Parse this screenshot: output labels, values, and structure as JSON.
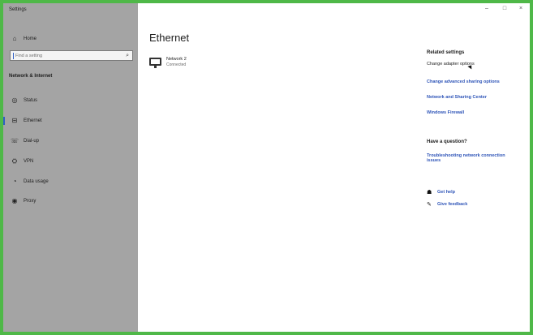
{
  "window": {
    "title": "Settings",
    "minimize": "–",
    "maximize": "□",
    "close": "×"
  },
  "sidebar": {
    "home": {
      "icon": "home-icon",
      "glyph": "⌂",
      "label": "Home"
    },
    "search": {
      "placeholder": "Find a setting",
      "icon": "search-icon",
      "glyph": "⌕"
    },
    "section": "Network & Internet",
    "items": [
      {
        "id": "status",
        "icon": "globe-icon",
        "glyph": "◎",
        "label": "Status",
        "active": false
      },
      {
        "id": "ethernet",
        "icon": "ethernet-icon",
        "glyph": "⊟",
        "label": "Ethernet",
        "active": true
      },
      {
        "id": "dialup",
        "icon": "phone-icon",
        "glyph": "☏",
        "label": "Dial-up",
        "active": false
      },
      {
        "id": "vpn",
        "icon": "vpn-icon",
        "glyph": "⛭",
        "label": "VPN",
        "active": false
      },
      {
        "id": "datausage",
        "icon": "data-usage-icon",
        "glyph": "◔",
        "label": "Data usage",
        "active": false
      },
      {
        "id": "proxy",
        "icon": "proxy-icon",
        "glyph": "◉",
        "label": "Proxy",
        "active": false
      }
    ]
  },
  "main": {
    "title": "Ethernet",
    "network": {
      "icon": "monitor-icon",
      "name": "Network 2",
      "status": "Connected"
    }
  },
  "related": {
    "heading": "Related settings",
    "links": [
      {
        "label": "Change adapter options",
        "style": "plain"
      },
      {
        "label": "Change advanced sharing options",
        "style": "link"
      },
      {
        "label": "Network and Sharing Center",
        "style": "link"
      },
      {
        "label": "Windows Firewall",
        "style": "link"
      }
    ]
  },
  "question": {
    "heading": "Have a question?",
    "link_line1": "Troubleshooting network connection",
    "link_line2": "issues"
  },
  "help": [
    {
      "icon": "get-help-icon",
      "glyph": "☗",
      "label": "Get help"
    },
    {
      "icon": "feedback-icon",
      "glyph": "✎",
      "label": "Give feedback"
    }
  ],
  "colors": {
    "accent": "#2f55b8",
    "sidebar_bg": "#a4a4a4",
    "frame_border": "#4fb848"
  }
}
